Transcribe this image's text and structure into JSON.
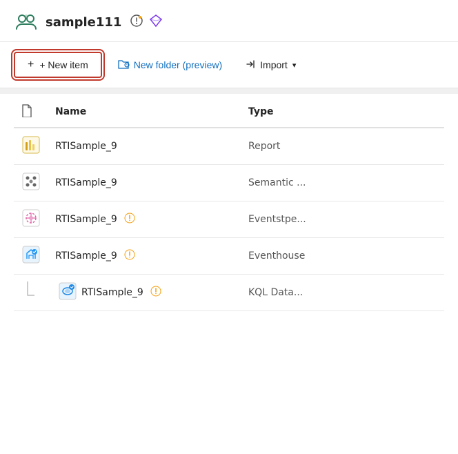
{
  "header": {
    "title": "sample111",
    "icons": [
      "settings-warning-icon",
      "diamond-icon"
    ]
  },
  "toolbar": {
    "new_item_label": "+ New item",
    "new_folder_label": "New folder (preview)",
    "import_label": "Import"
  },
  "table": {
    "columns": [
      "",
      "Name",
      "Type"
    ],
    "rows": [
      {
        "name": "RTISample_9",
        "type": "Report",
        "icon_type": "report",
        "has_badge": false,
        "badge": "",
        "sub_item": false
      },
      {
        "name": "RTISample_9",
        "type": "Semantic ...",
        "icon_type": "semantic",
        "has_badge": false,
        "badge": "",
        "sub_item": false
      },
      {
        "name": "RTISample_9",
        "type": "Eventstре...",
        "icon_type": "eventstream",
        "has_badge": true,
        "badge": "⚠",
        "sub_item": false
      },
      {
        "name": "RTISample_9",
        "type": "Eventhouse",
        "icon_type": "eventhouse",
        "has_badge": true,
        "badge": "⚠",
        "sub_item": false
      },
      {
        "name": "RTISample_9",
        "type": "KQL Data...",
        "icon_type": "kql",
        "has_badge": true,
        "badge": "⚠",
        "sub_item": true
      }
    ]
  }
}
